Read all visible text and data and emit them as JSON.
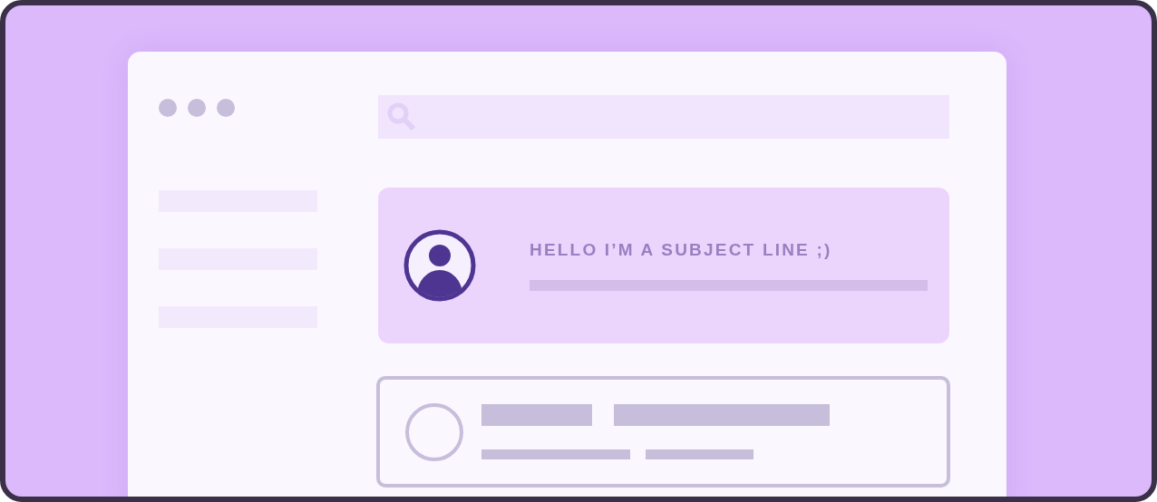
{
  "messages": [
    {
      "subject": "HELLO I’M A SUBJECT LINE ;)",
      "selected": true
    },
    {
      "selected": false
    }
  ]
}
